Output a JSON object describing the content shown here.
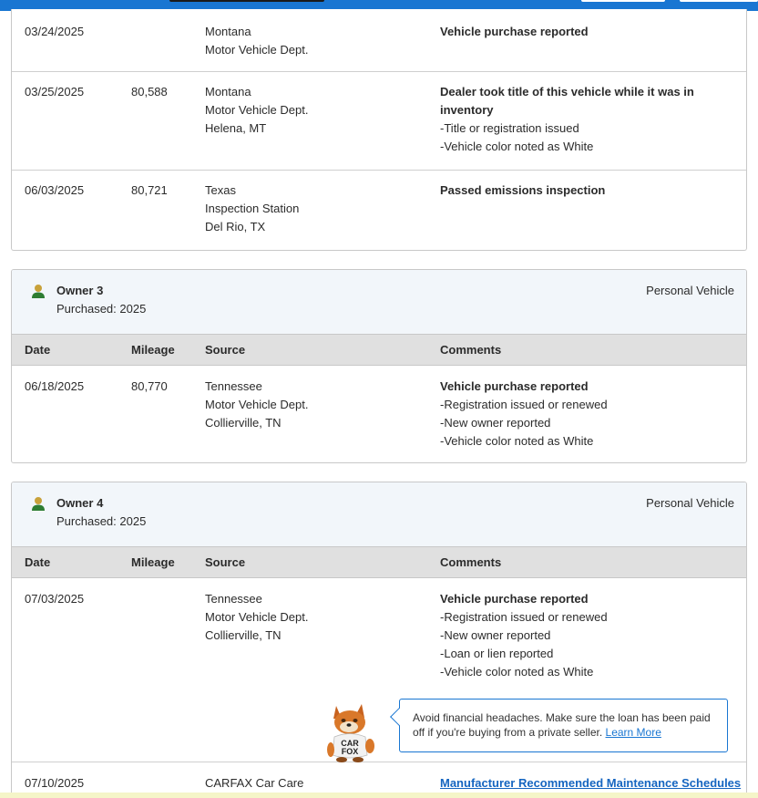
{
  "colors": {
    "topbar": "#1976d2",
    "owner_icon": "#2e7d32",
    "link": "#1565c0",
    "header_bg": "#e0e0e0",
    "owner_bg": "#f2f6fa"
  },
  "table_headers": {
    "date": "Date",
    "mileage": "Mileage",
    "source": "Source",
    "comments": "Comments"
  },
  "card1": {
    "rows": [
      {
        "date": "03/24/2025",
        "mileage": "",
        "source": [
          "Montana",
          "Motor Vehicle Dept."
        ],
        "comment_title": "Vehicle purchase reported",
        "bullets": []
      },
      {
        "date": "03/25/2025",
        "mileage": "80,588",
        "source": [
          "Montana",
          "Motor Vehicle Dept.",
          "Helena, MT"
        ],
        "comment_title": [
          "Dealer took title of this vehicle while it was in",
          "inventory"
        ],
        "bullets": [
          "Title or registration issued",
          "Vehicle color noted as White"
        ]
      },
      {
        "date": "06/03/2025",
        "mileage": "80,721",
        "source": [
          "Texas",
          "Inspection Station",
          "Del Rio, TX"
        ],
        "comment_title": "Passed emissions inspection",
        "bullets": []
      }
    ]
  },
  "owner3": {
    "title": "Owner 3",
    "purchased": "Purchased: 2025",
    "type": "Personal Vehicle",
    "rows": [
      {
        "date": "06/18/2025",
        "mileage": "80,770",
        "source": [
          "Tennessee",
          "Motor Vehicle Dept.",
          "Collierville, TN"
        ],
        "comment_title": "Vehicle purchase reported",
        "bullets": [
          "Registration issued or renewed",
          "New owner reported",
          "Vehicle color noted as White"
        ]
      }
    ]
  },
  "owner4": {
    "title": "Owner 4",
    "purchased": "Purchased: 2025",
    "type": "Personal Vehicle",
    "rows": [
      {
        "date": "07/03/2025",
        "mileage": "",
        "source": [
          "Tennessee",
          "Motor Vehicle Dept.",
          "Collierville, TN"
        ],
        "comment_title": "Vehicle purchase reported",
        "bullets": [
          "Registration issued or renewed",
          "New owner reported",
          "Loan or lien reported",
          "Vehicle color noted as White"
        ]
      },
      {
        "date": "07/10/2025",
        "mileage": "",
        "source": [
          "CARFAX Car Care"
        ],
        "comment_link": "Manufacturer Recommended Maintenance Schedules"
      }
    ],
    "callout": {
      "text": "Avoid financial headaches. Make sure the loan has been paid off if you're buying from a private seller.",
      "link": "Learn More"
    }
  },
  "mascot": {
    "shirt_line1": "CAR",
    "shirt_line2": "FOX"
  }
}
